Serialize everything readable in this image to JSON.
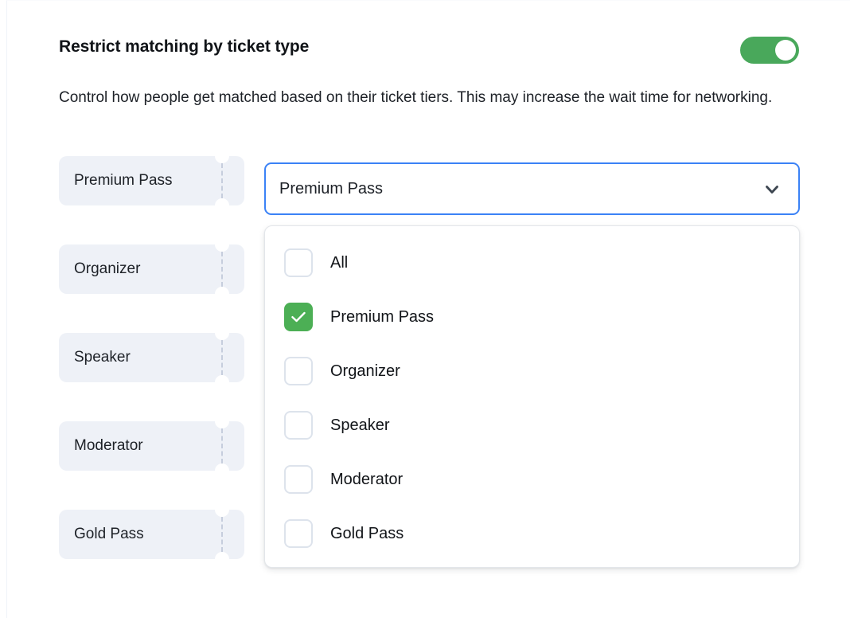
{
  "section": {
    "title": "Restrict matching by ticket type",
    "description": "Control how people get matched based on their ticket tiers. This may increase the wait time for networking.",
    "toggle": {
      "state": "on",
      "on_color": "#49a85b",
      "knob_color": "#ffffff"
    }
  },
  "ticket_chips": [
    {
      "label": "Premium Pass"
    },
    {
      "label": "Organizer"
    },
    {
      "label": "Speaker"
    },
    {
      "label": "Moderator"
    },
    {
      "label": "Gold Pass"
    }
  ],
  "select": {
    "value": "Premium Pass",
    "icon": "chevron-down-icon",
    "focus_border_color": "#3b82f6",
    "expanded": true
  },
  "dropdown": {
    "options": [
      {
        "label": "All",
        "checked": false
      },
      {
        "label": "Premium Pass",
        "checked": true
      },
      {
        "label": "Organizer",
        "checked": false
      },
      {
        "label": "Speaker",
        "checked": false
      },
      {
        "label": "Moderator",
        "checked": false
      },
      {
        "label": "Gold Pass",
        "checked": false
      }
    ],
    "checked_color": "#4caf55",
    "unchecked_border_color": "#dde3ec"
  },
  "colors": {
    "chip_background": "#eef1f7",
    "chip_perforation": "#c6cedd",
    "text_primary": "#111418",
    "text_body": "#1d2127",
    "page_background": "#ffffff"
  }
}
